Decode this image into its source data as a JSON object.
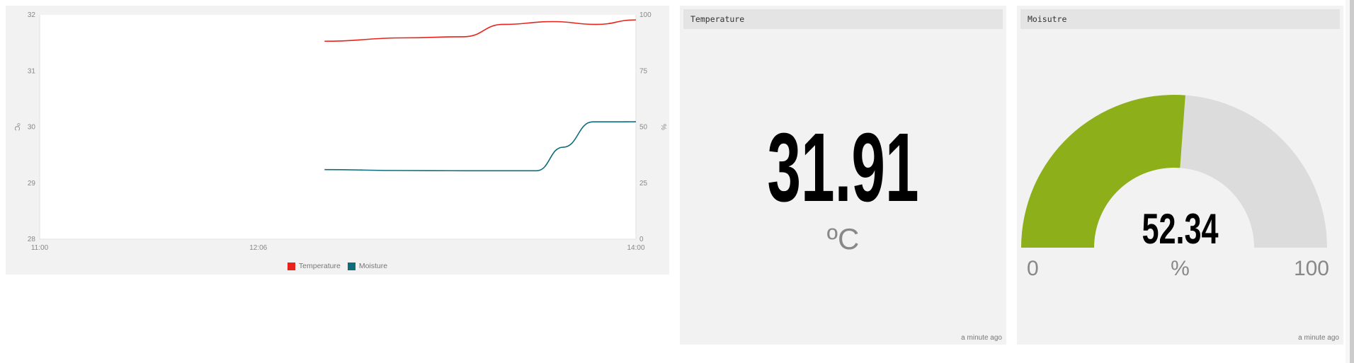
{
  "chart_data": {
    "type": "line",
    "x_ticks": [
      "11:00",
      "12:06",
      "14:00"
    ],
    "y_left": {
      "label": "ºC",
      "range": [
        28,
        32
      ],
      "ticks": [
        "28",
        "29",
        "30",
        "31",
        "32"
      ]
    },
    "y_right": {
      "label": "%",
      "range": [
        0,
        100
      ],
      "ticks": [
        "0",
        "25",
        "50",
        "75",
        "100"
      ]
    },
    "series": [
      {
        "name": "Temperature",
        "axis": "left",
        "color": "#e8231c",
        "x": [
          "12:26",
          "12:50",
          "13:08",
          "13:20",
          "13:35",
          "13:48",
          "14:00"
        ],
        "y": [
          31.53,
          31.59,
          31.61,
          31.83,
          31.88,
          31.83,
          31.91
        ]
      },
      {
        "name": "Moisture",
        "axis": "right",
        "color": "#0d6d7a",
        "x": [
          "12:26",
          "12:50",
          "13:08",
          "13:30",
          "13:38",
          "13:47",
          "13:52",
          "14:00"
        ],
        "y": [
          31,
          30.6,
          30.5,
          30.5,
          41,
          52.3,
          52.3,
          52.34
        ]
      }
    ],
    "grid": true,
    "legend_position": "bottom"
  },
  "legend": {
    "temperature": "Temperature",
    "moisture": "Moisture"
  },
  "temperature_widget": {
    "title": "Temperature",
    "value": "31.91",
    "unit": "ºC",
    "updated": "a minute ago"
  },
  "moisture_widget": {
    "title": "Moisutre",
    "value": "52.34",
    "min": "0",
    "max": "100",
    "unit": "%",
    "updated": "a minute ago",
    "fill_color": "#8db01a",
    "track_color": "#dcdcdc",
    "fraction": 0.5234
  }
}
